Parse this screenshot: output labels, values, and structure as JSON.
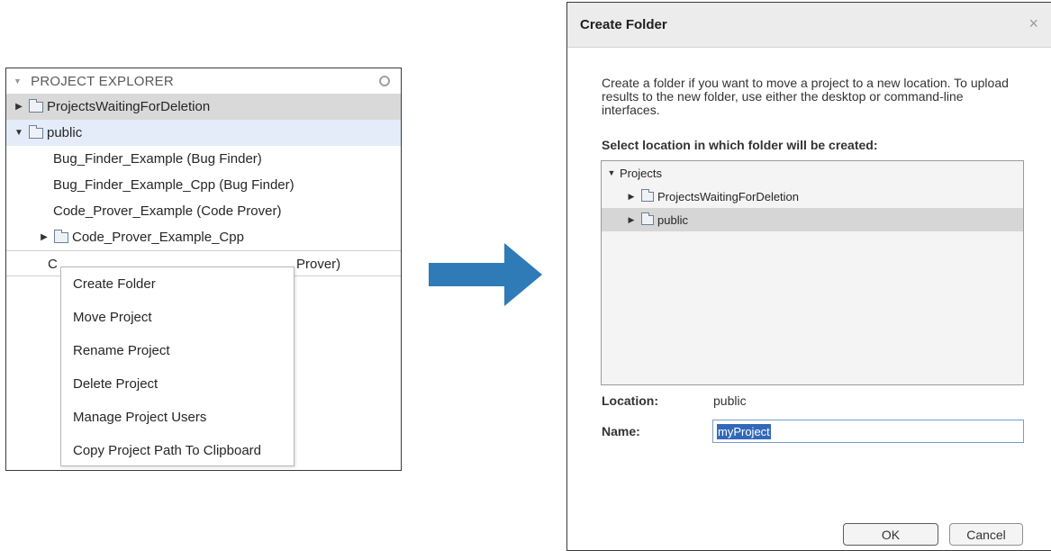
{
  "explorer": {
    "title": "PROJECT EXPLORER",
    "rows": [
      {
        "label": "ProjectsWaitingForDeletion",
        "type": "folder",
        "expanded": false
      },
      {
        "label": "public",
        "type": "folder",
        "expanded": true
      },
      {
        "label": "Bug_Finder_Example (Bug Finder)",
        "type": "project"
      },
      {
        "label": "Bug_Finder_Example_Cpp (Bug Finder)",
        "type": "project"
      },
      {
        "label": "Code_Prover_Example (Code Prover)",
        "type": "project"
      },
      {
        "label": "Code_Prover_Example_Cpp",
        "type": "folder",
        "expanded": false
      }
    ],
    "partial_row": {
      "left": "C",
      "right": "Prover)"
    }
  },
  "context_menu": {
    "items": [
      "Create Folder",
      "Move Project",
      "Rename Project",
      "Delete Project",
      "Manage Project Users",
      "Copy Project Path To Clipboard"
    ]
  },
  "dialog": {
    "title": "Create Folder",
    "close": "×",
    "description": "Create a folder if you want to move a project to a new location. To upload results to the new folder, use either the desktop or command-line interfaces.",
    "select_label": "Select location in which folder will be created:",
    "tree": {
      "root": "Projects",
      "children": [
        "ProjectsWaitingForDeletion",
        "public"
      ],
      "selected": "public"
    },
    "location_label": "Location:",
    "location_value": "public",
    "name_label": "Name:",
    "name_value": "myProject",
    "ok": "OK",
    "cancel": "Cancel"
  },
  "colors": {
    "arrow": "#2e7bb8",
    "selected_row": "#d9d9d9",
    "expanded_row": "#e3ecf8",
    "text_highlight": "#3268b8"
  }
}
